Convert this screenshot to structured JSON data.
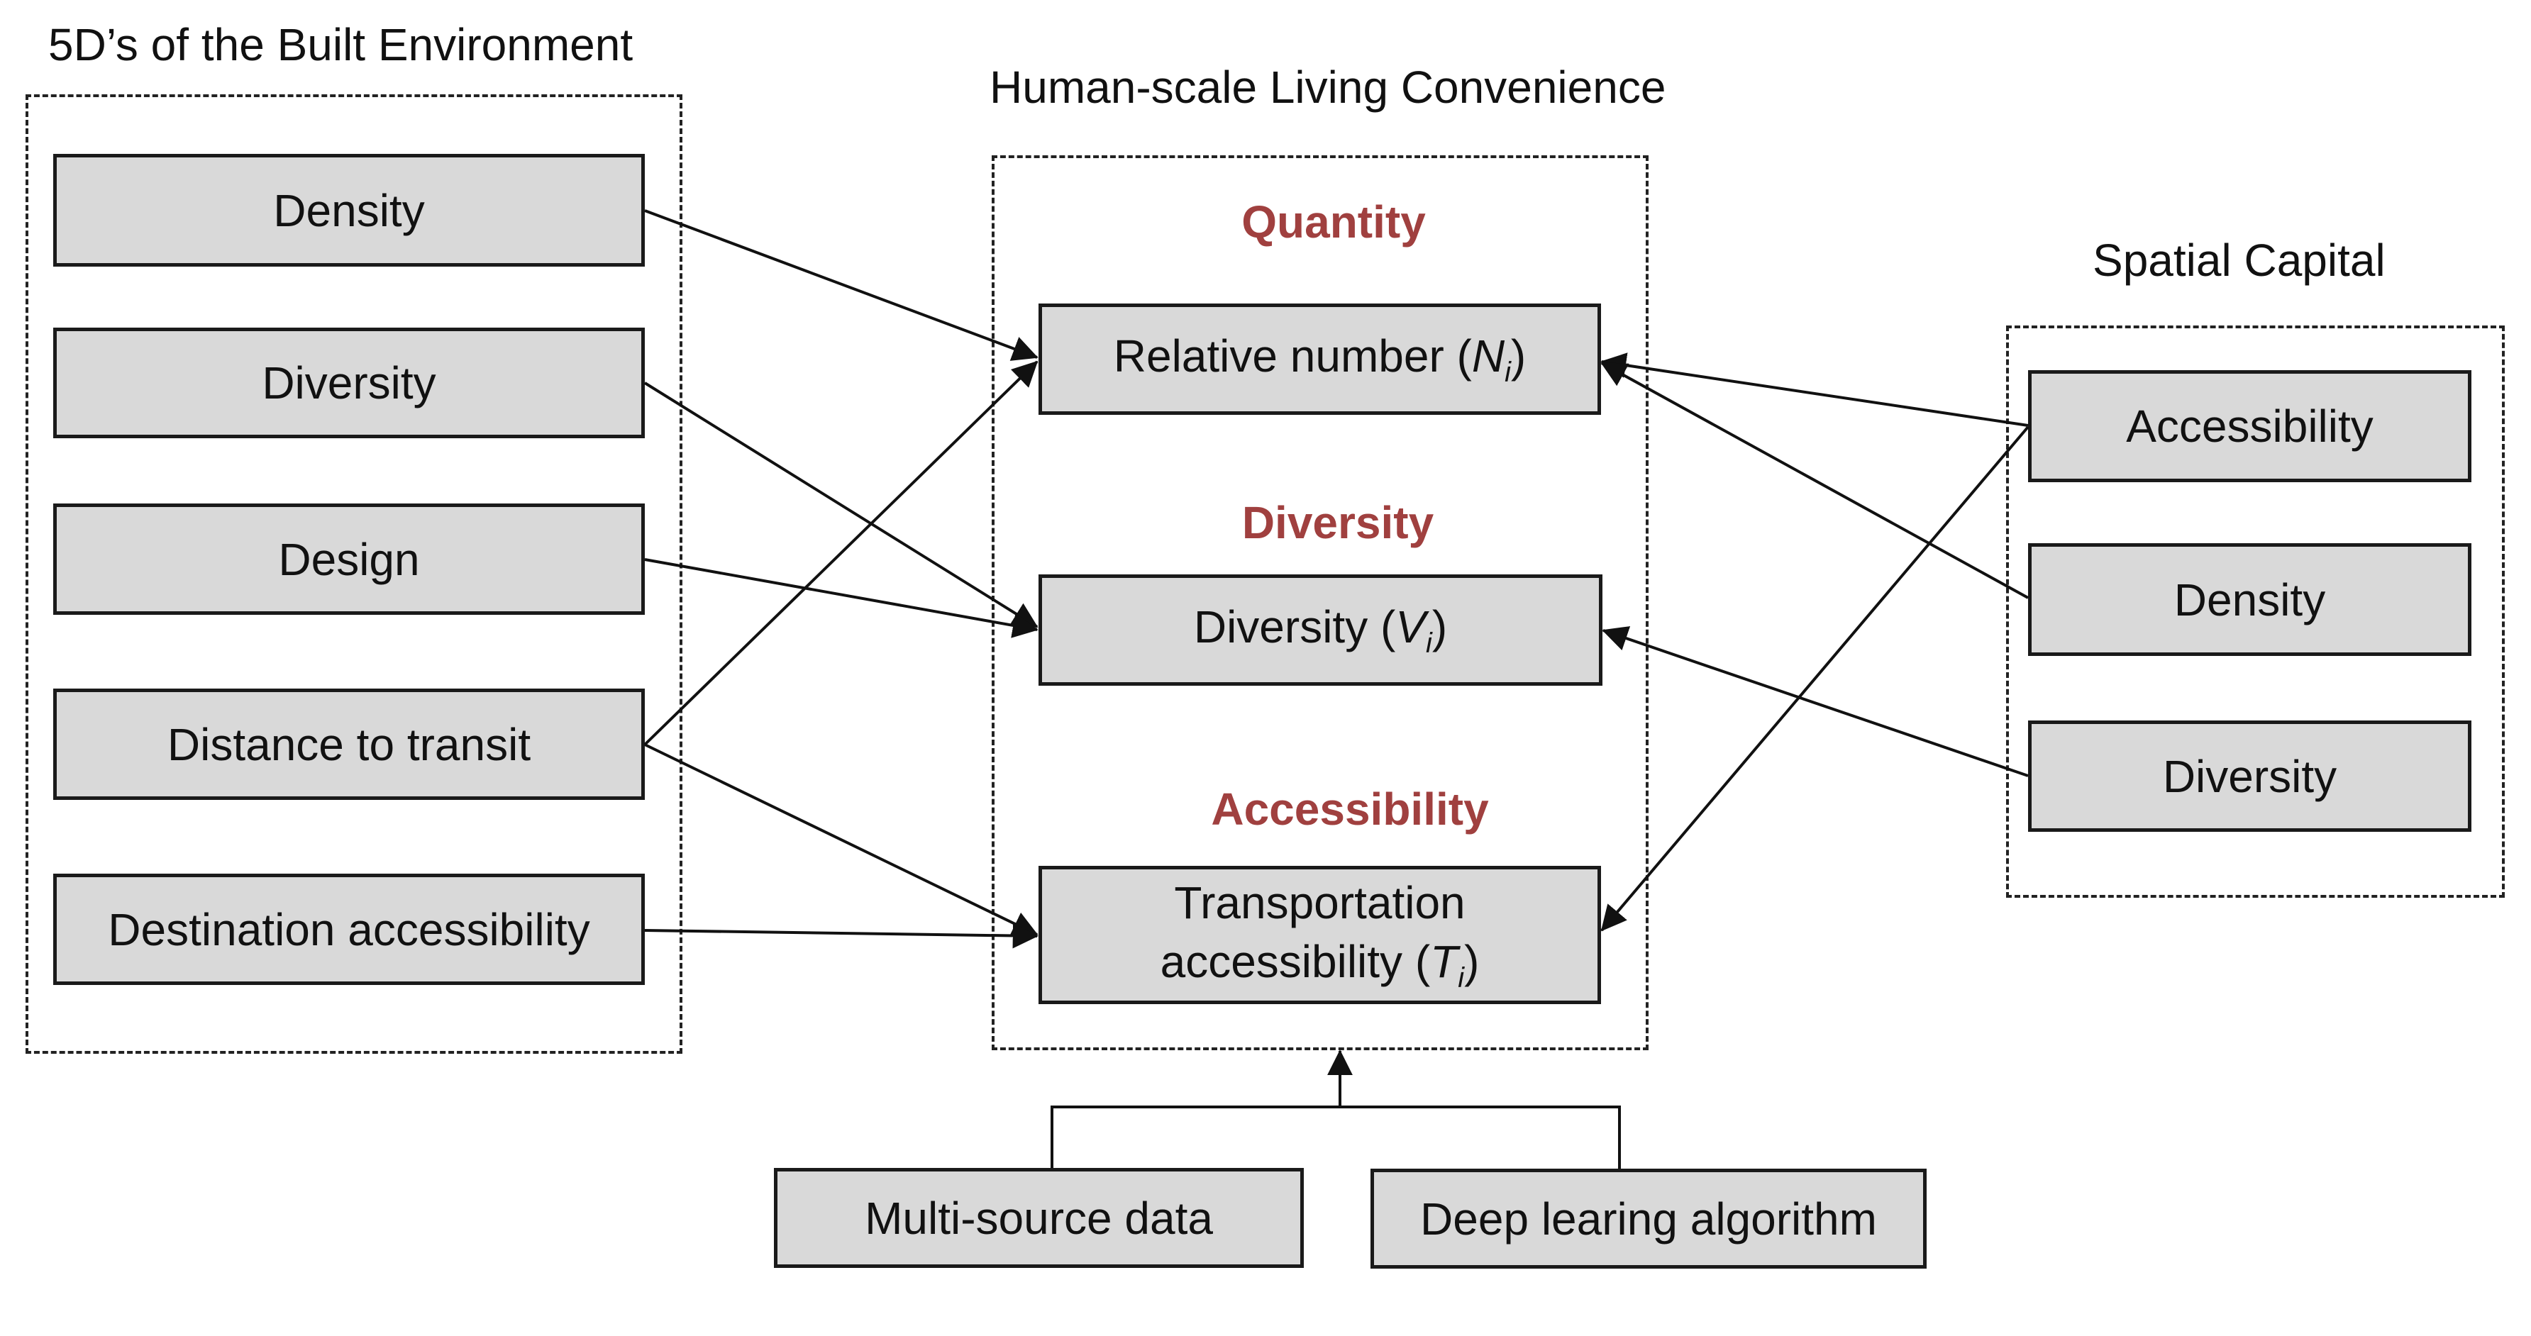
{
  "groups": {
    "built_environment": {
      "title": "5D’s of the Built Environment",
      "items": [
        "Density",
        "Diversity",
        "Design",
        "Distance to transit",
        "Destination accessibility"
      ]
    },
    "living_convenience": {
      "title": "Human-scale Living Convenience",
      "categories": [
        {
          "label": "Quantity",
          "node": {
            "text": "Relative number (",
            "symbol": "N",
            "sub": "i",
            "close": ")"
          }
        },
        {
          "label": "Diversity",
          "node": {
            "text": "Diversity (",
            "symbol": "V",
            "sub": "i",
            "close": ")"
          }
        },
        {
          "label": "Accessibility",
          "node": {
            "line1": "Transportation",
            "text": "accessibility (",
            "symbol": "T",
            "sub": "i",
            "close": ")"
          }
        }
      ]
    },
    "spatial_capital": {
      "title": "Spatial Capital",
      "items": [
        "Accessibility",
        "Density",
        "Diversity"
      ]
    }
  },
  "inputs": [
    "Multi-source data",
    "Deep learing algorithm"
  ],
  "edges": [
    {
      "from": "built_environment.Density",
      "to": "Relative number (Ni)"
    },
    {
      "from": "built_environment.Distance to transit",
      "to": "Relative number (Ni)"
    },
    {
      "from": "built_environment.Diversity",
      "to": "Diversity (Vi)"
    },
    {
      "from": "built_environment.Design",
      "to": "Diversity (Vi)"
    },
    {
      "from": "built_environment.Distance to transit",
      "to": "Transportation accessibility (Ti)"
    },
    {
      "from": "built_environment.Destination accessibility",
      "to": "Transportation accessibility (Ti)"
    },
    {
      "from": "spatial_capital.Accessibility",
      "to": "Relative number (Ni)"
    },
    {
      "from": "spatial_capital.Density",
      "to": "Relative number (Ni)"
    },
    {
      "from": "spatial_capital.Diversity",
      "to": "Diversity (Vi)"
    },
    {
      "from": "spatial_capital.Accessibility",
      "to": "Transportation accessibility (Ti)"
    },
    {
      "from": "inputs",
      "to": "Human-scale Living Convenience"
    }
  ],
  "colors": {
    "category_label": "#a0403f",
    "node_fill": "#d9d9d9",
    "stroke": "#111111"
  }
}
